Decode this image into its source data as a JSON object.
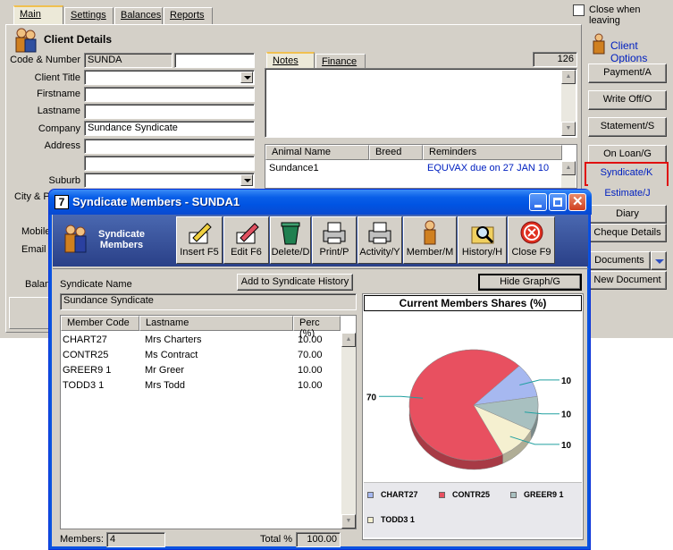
{
  "tabs": [
    "Main",
    "Settings",
    "Balances",
    "Reports"
  ],
  "close_when_leaving": "Close when leaving",
  "client_details": {
    "title": "Client Details",
    "labels": {
      "code": "Code & Number",
      "title": "Client Title",
      "firstname": "Firstname",
      "lastname": "Lastname",
      "company": "Company",
      "address": "Address",
      "suburb": "Suburb",
      "city": "City & Po",
      "mobile": "Mobile",
      "email": "Email A",
      "balance": "Balan"
    },
    "code_value": "SUNDA",
    "company_value": "Sundance Syndicate"
  },
  "notes": {
    "tabs": [
      "Notes",
      "Finance"
    ],
    "count": "126"
  },
  "animals": {
    "headers": [
      "Animal Name",
      "Breed",
      "Reminders"
    ],
    "rows": [
      {
        "name": "Sundance1",
        "breed": "",
        "reminder": "EQUVAX due on 27 JAN 10"
      }
    ]
  },
  "client_options": {
    "title": "Client Options",
    "buttons": [
      "Payment/A",
      "Write Off/O",
      "Statement/S",
      "On Loan/G",
      "Syndicate/K",
      "Estimate/J",
      "Diary",
      "Cheque Details",
      "Documents",
      "New Document"
    ]
  },
  "dialog": {
    "title": "Syndicate Members  - SUNDA1",
    "title_icon": "7",
    "header_label": "Syndicate Members",
    "toolbar": [
      "Insert F5",
      "Edit F6",
      "Delete/D",
      "Print/P",
      "Activity/Y",
      "Member/M",
      "History/H",
      "Close F9"
    ],
    "syndicate_name_label": "Syndicate Name",
    "syndicate_name": "Sundance Syndicate",
    "add_history": "Add to Syndicate History",
    "hide_graph": "Hide Graph/G",
    "columns": [
      "Member Code",
      "Lastname",
      "Perc (%)"
    ],
    "members": [
      {
        "code": "CHART27",
        "lastname": "Mrs Charters",
        "perc": "10.00"
      },
      {
        "code": "CONTR25",
        "lastname": "Ms Contract",
        "perc": "70.00"
      },
      {
        "code": "GREER9 1",
        "lastname": "Mr Greer",
        "perc": "10.00"
      },
      {
        "code": "TODD3 1",
        "lastname": "Mrs Todd",
        "perc": "10.00"
      }
    ],
    "members_label": "Members:",
    "members_count": "4",
    "total_label": "Total %",
    "total_value": "100.00"
  },
  "chart_data": {
    "type": "pie",
    "title": "Current Members Shares (%)",
    "categories": [
      "CHART27",
      "CONTR25",
      "GREER9 1",
      "TODD3 1"
    ],
    "values": [
      10,
      70,
      10,
      10
    ],
    "data_labels": [
      "10",
      "70",
      "10",
      "10"
    ],
    "colors": [
      "#a6b8f0",
      "#e85060",
      "#a8c0c0",
      "#f5f0d0"
    ],
    "legend": "bottom"
  }
}
